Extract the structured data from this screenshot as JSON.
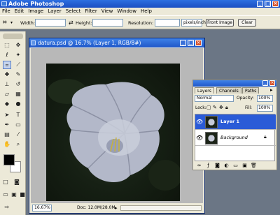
{
  "window": {
    "title": "Adobe Photoshop",
    "controls": [
      "_",
      "□",
      "×"
    ]
  },
  "menubar": {
    "items": [
      "File",
      "Edit",
      "Image",
      "Layer",
      "Select",
      "Filter",
      "View",
      "Window",
      "Help"
    ]
  },
  "options": {
    "width_label": "Width:",
    "height_label": "Height:",
    "resolution_label": "Resolution:",
    "resolution_unit": "pixels/inch",
    "front_image": "Front Image",
    "clear": "Clear"
  },
  "document": {
    "title": "datura.psd @ 16.7% (Layer 1, RGB/8#)",
    "zoom": "16.67%",
    "doc_info": "Doc: 12.0M/28.0M"
  },
  "layers_panel": {
    "tabs": [
      "Layers",
      "Channels",
      "Paths"
    ],
    "blend_mode": "Normal",
    "opacity_label": "Opacity:",
    "opacity_value": "100%",
    "lock_label": "Lock:",
    "fill_label": "Fill:",
    "fill_value": "100%",
    "layers": [
      {
        "name": "Layer 1",
        "selected": true
      },
      {
        "name": "Background",
        "selected": false
      }
    ]
  },
  "colors": {
    "foreground": "#000000",
    "background": "#ffffff",
    "selection": "#2a5bd7"
  }
}
